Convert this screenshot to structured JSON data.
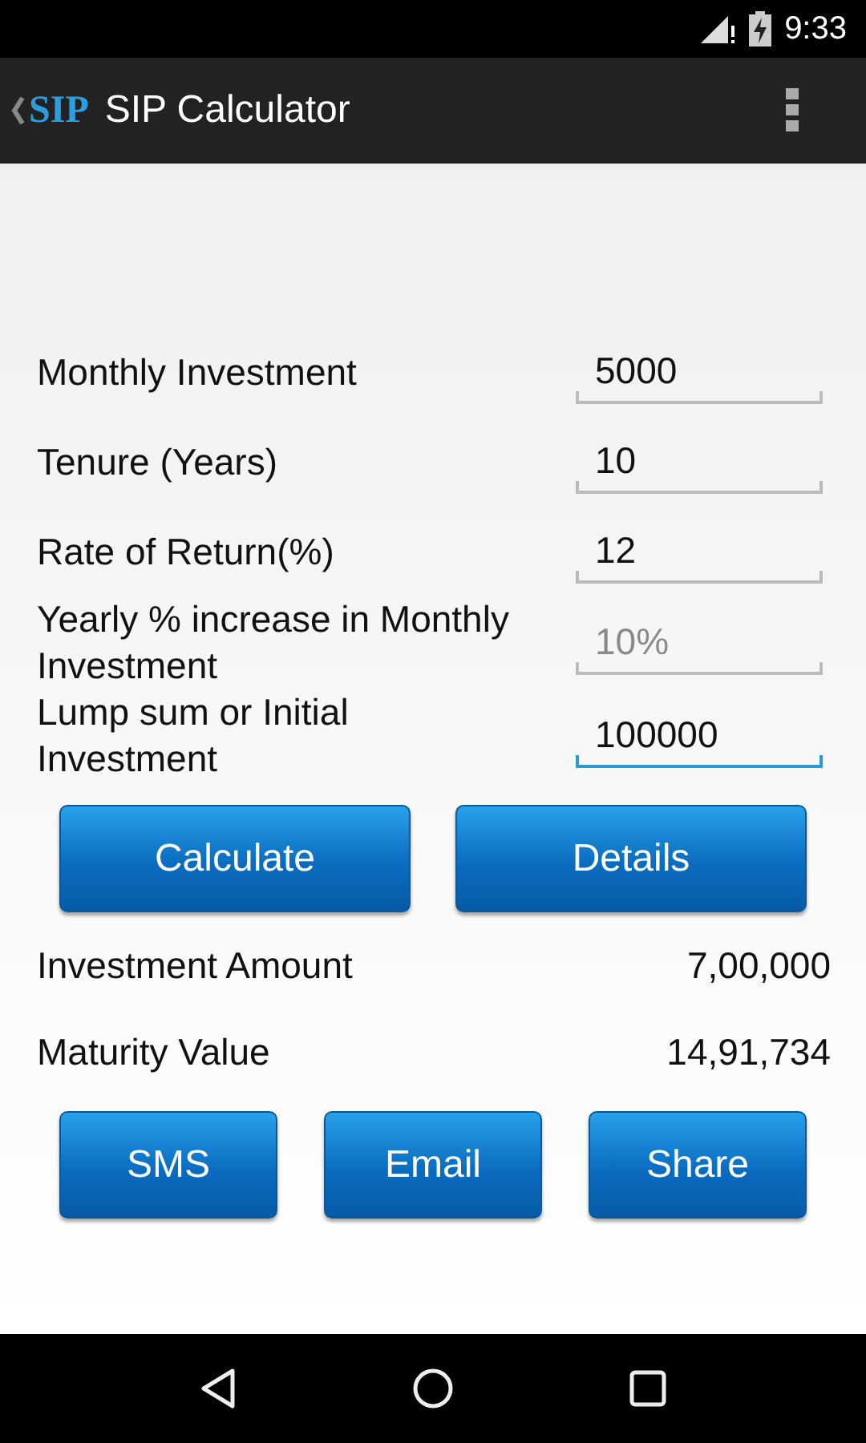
{
  "status_bar": {
    "time": "9:33"
  },
  "app_bar": {
    "logo_text": "SIP",
    "title": "SIP Calculator"
  },
  "fields": [
    {
      "label": "Monthly Investment",
      "value": "5000",
      "focused": false
    },
    {
      "label": "Tenure (Years)",
      "value": "10",
      "focused": false
    },
    {
      "label": "Rate of Return(%)",
      "value": "12",
      "focused": false
    },
    {
      "label": "Yearly % increase in Monthly Investment",
      "placeholder": "10%",
      "focused": false
    },
    {
      "label": "Lump sum or Initial Investment",
      "value": "100000",
      "focused": true
    }
  ],
  "actions": [
    "Calculate",
    "Details"
  ],
  "results": [
    {
      "label": "Investment Amount",
      "value": "7,00,000"
    },
    {
      "label": "Maturity Value",
      "value": "14,91,734"
    }
  ],
  "share_buttons": [
    "SMS",
    "Email",
    "Share"
  ]
}
